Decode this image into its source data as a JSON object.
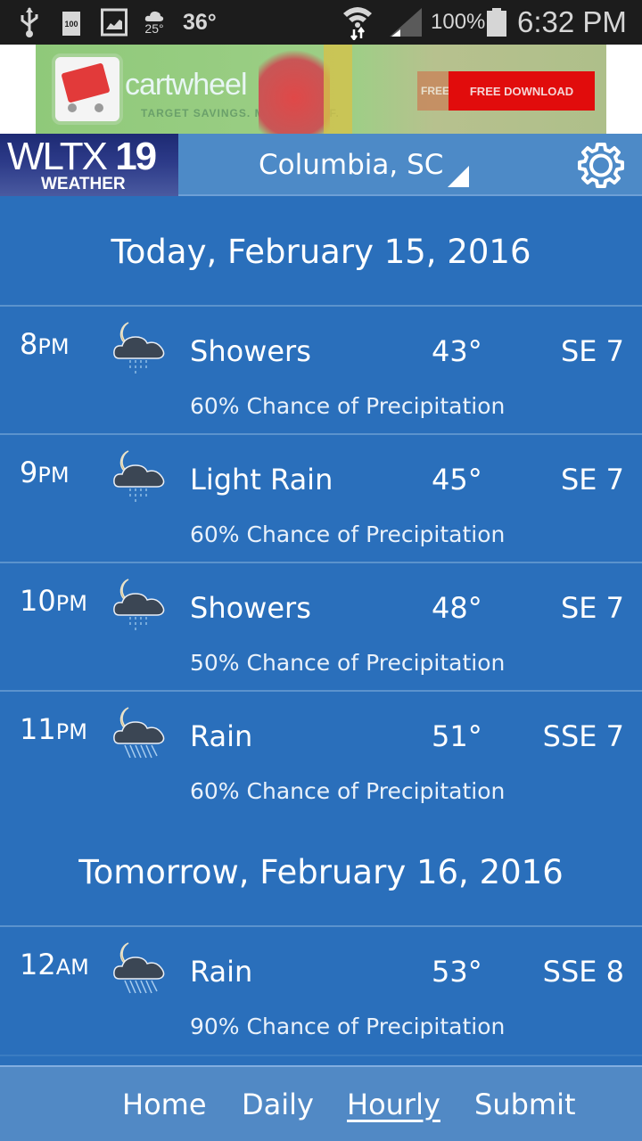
{
  "status_bar": {
    "left_icons": [
      "usb-icon",
      "battery-100-icon",
      "gallery-icon",
      "weather-cloud-icon"
    ],
    "battery_small_label": "100",
    "weather_small_temp": "25°",
    "weather_temp": "36°",
    "right_icons": [
      "wifi-icon",
      "signal-icon",
      "battery-icon"
    ],
    "battery_percent": "100%",
    "time": "6:32 PM"
  },
  "ad": {
    "brand": "cartwheel",
    "tagline": "TARGET SAVINGS. MOBILE-SELF.",
    "free_label": "FREE",
    "cta": "FREE DOWNLOAD"
  },
  "header": {
    "logo_main": "WLTX",
    "logo_number": "19",
    "logo_sub": "WEATHER",
    "location": "Columbia, SC"
  },
  "days": [
    {
      "title": "Today, February 15, 2016",
      "hours": [
        {
          "hour": "8",
          "ampm": "PM",
          "icon": "night-showers-icon",
          "condition": "Showers",
          "temp": "43°",
          "wind": "SE 7",
          "precip": "60% Chance of Precipitation"
        },
        {
          "hour": "9",
          "ampm": "PM",
          "icon": "night-showers-icon",
          "condition": "Light Rain",
          "temp": "45°",
          "wind": "SE 7",
          "precip": "60% Chance of Precipitation"
        },
        {
          "hour": "10",
          "ampm": "PM",
          "icon": "night-showers-icon",
          "condition": "Showers",
          "temp": "48°",
          "wind": "SE 7",
          "precip": "50% Chance of Precipitation"
        },
        {
          "hour": "11",
          "ampm": "PM",
          "icon": "night-rain-icon",
          "condition": "Rain",
          "temp": "51°",
          "wind": "SSE 7",
          "precip": "60% Chance of Precipitation"
        }
      ]
    },
    {
      "title": "Tomorrow, February 16, 2016",
      "hours": [
        {
          "hour": "12",
          "ampm": "AM",
          "icon": "night-rain-icon",
          "condition": "Rain",
          "temp": "53°",
          "wind": "SSE 8",
          "precip": "90% Chance of Precipitation"
        }
      ]
    }
  ],
  "nav": {
    "items": [
      {
        "label": "Home",
        "active": false
      },
      {
        "label": "Daily",
        "active": false
      },
      {
        "label": "Hourly",
        "active": true
      },
      {
        "label": "Submit",
        "active": false
      }
    ]
  },
  "colors": {
    "background": "#2a6fbb",
    "header": "#4d8ac7",
    "nav": "#5189c5",
    "moon": "#b38a37",
    "cloud": "#3b4654"
  }
}
